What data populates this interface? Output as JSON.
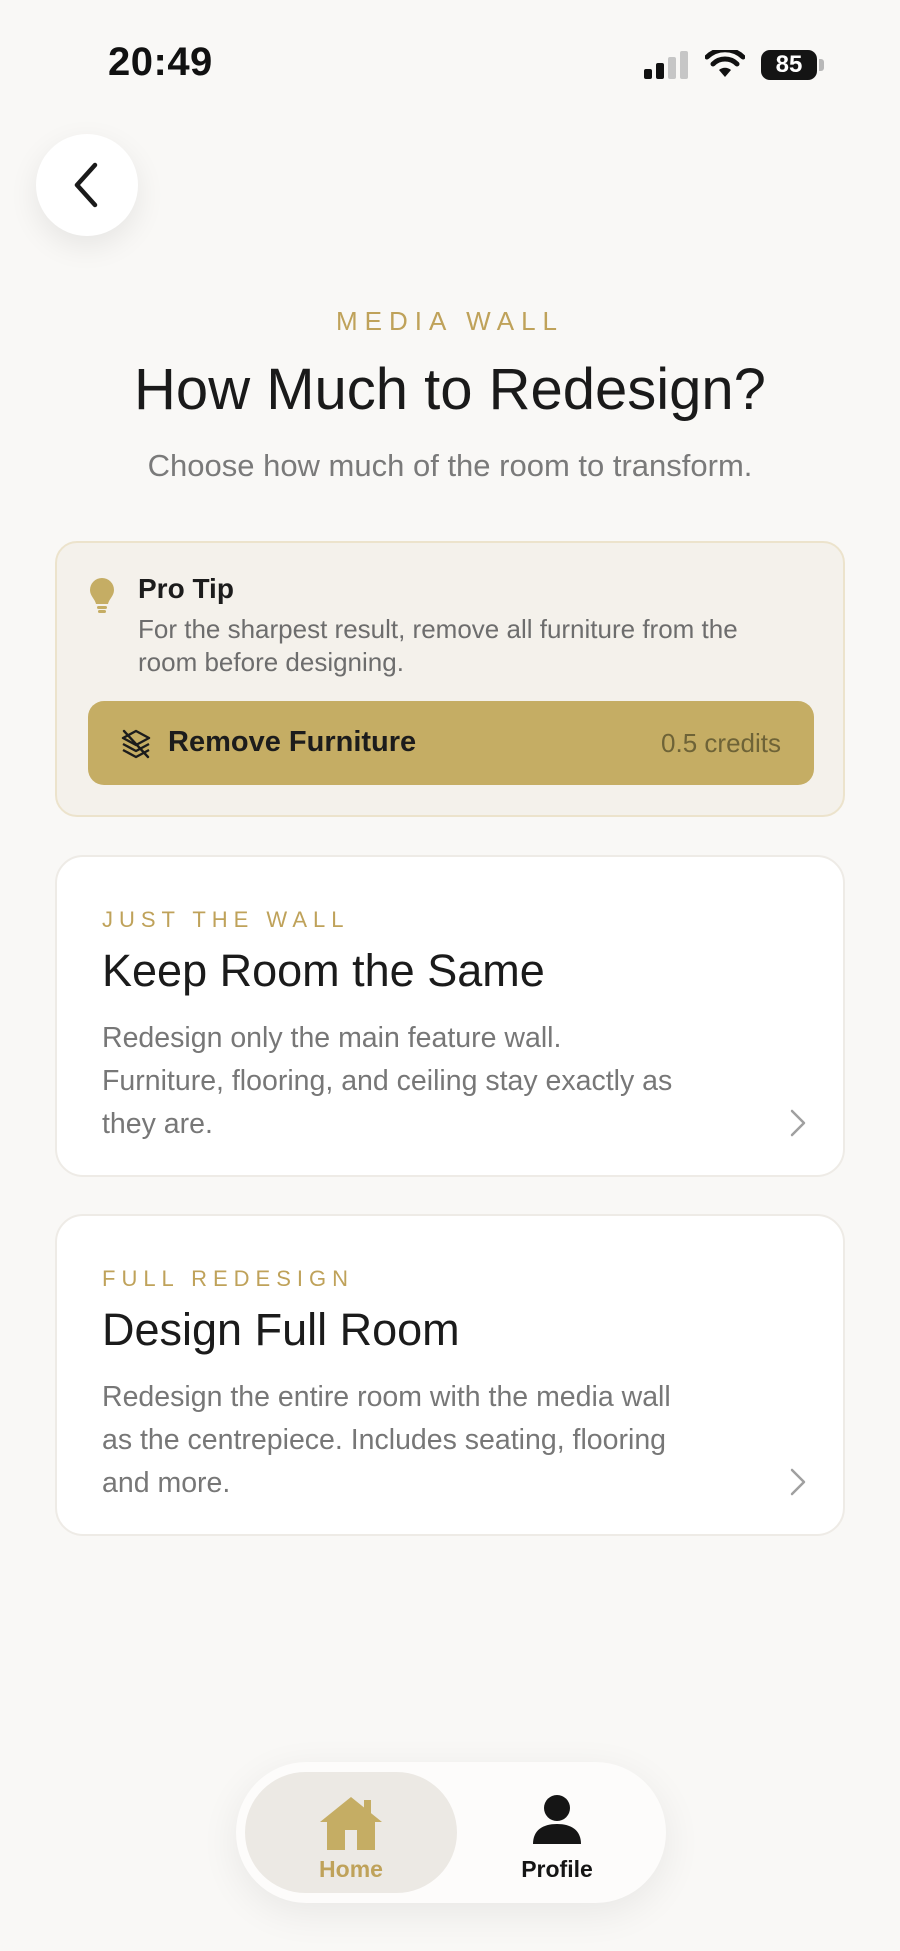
{
  "status_bar": {
    "time": "20:49",
    "battery": "85"
  },
  "header": {
    "eyebrow": "MEDIA WALL",
    "title": "How Much to Redesign?",
    "subtitle": "Choose how much of the room to transform."
  },
  "pro_tip": {
    "title": "Pro Tip",
    "text": "For the sharpest result, remove all furniture from the room before designing.",
    "button_label": "Remove Furniture",
    "button_credits": "0.5 credits"
  },
  "options": [
    {
      "eyebrow": "JUST THE WALL",
      "title": "Keep Room the Same",
      "description": "Redesign only the main feature wall. Furniture, flooring, and ceiling stay exactly as they are."
    },
    {
      "eyebrow": "FULL REDESIGN",
      "title": "Design Full Room",
      "description": "Redesign the entire room with the media wall as the centrepiece. Includes seating, flooring and more."
    }
  ],
  "bottom_nav": {
    "home_label": "Home",
    "profile_label": "Profile",
    "active": "Home"
  },
  "colors": {
    "accent": "#c5ad64",
    "accent_text": "#bfa25a",
    "background": "#f9f8f6"
  },
  "icons": {
    "back": "chevron-left-icon",
    "tip": "lightbulb-icon",
    "remove": "layers-off-icon",
    "option_arrow": "chevron-right-icon",
    "home": "home-icon",
    "profile": "person-icon"
  }
}
